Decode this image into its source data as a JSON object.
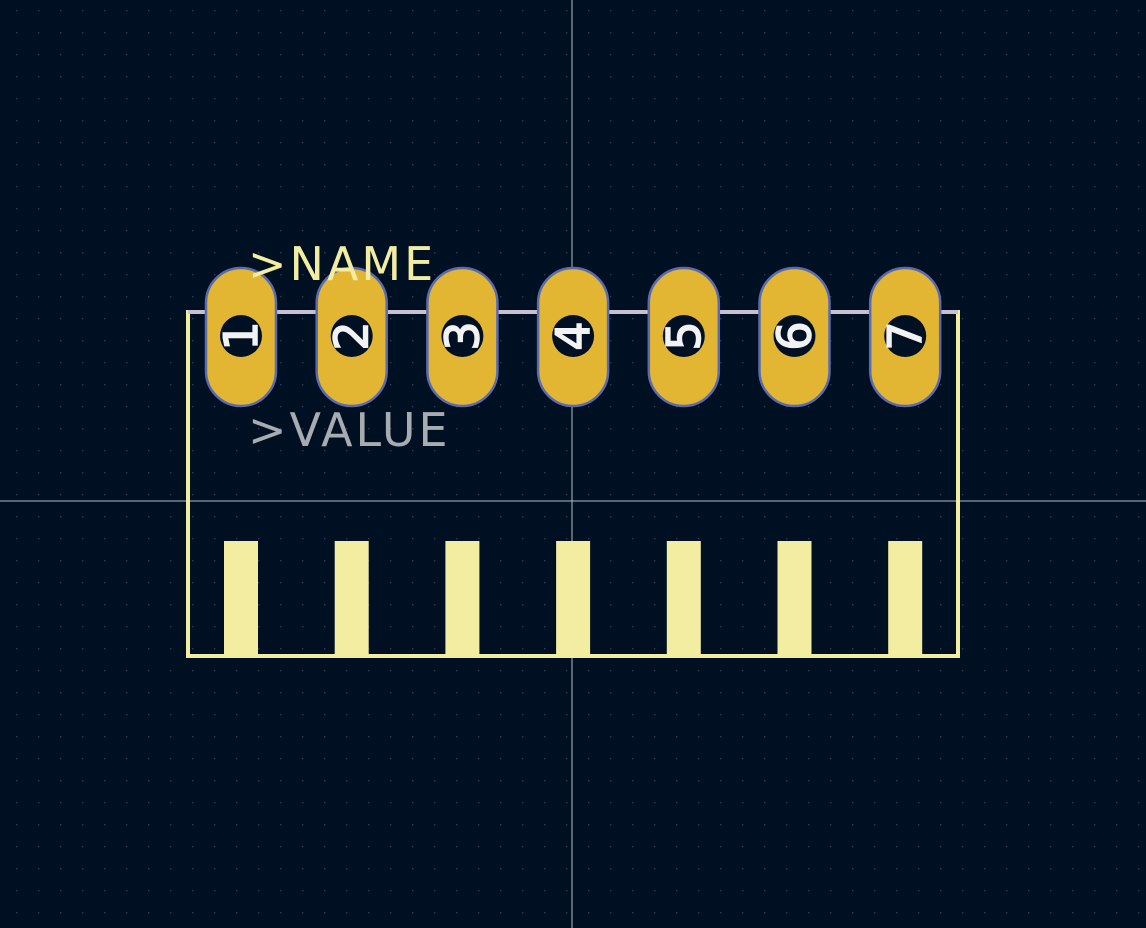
{
  "colors": {
    "background": "#001023",
    "grid_dot": "#2b3a52",
    "crosshair": "#b6bcc4",
    "silkscreen": "#f2eda1",
    "pad_fill": "#e2b632",
    "pad_outline": "#5a6bb0",
    "pad_hole": "#001023",
    "pad_number": "#f2f2f2",
    "fab_line": "#c8bfd2",
    "value_text": "#a8abb0"
  },
  "footprint": {
    "name_text": ">NAME",
    "value_text": ">VALUE",
    "pads": [
      {
        "number": "1"
      },
      {
        "number": "2"
      },
      {
        "number": "3"
      },
      {
        "number": "4"
      },
      {
        "number": "5"
      },
      {
        "number": "6"
      },
      {
        "number": "7"
      }
    ]
  }
}
